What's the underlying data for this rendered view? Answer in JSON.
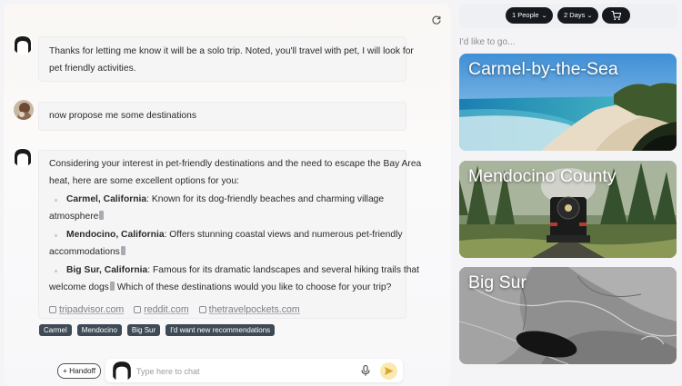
{
  "chat": {
    "messages": [
      {
        "role": "assistant",
        "lines": [
          "Thanks for letting me know it will be a solo trip. Noted, you'll travel with pet, I will look for",
          "pet friendly activities."
        ]
      },
      {
        "role": "user",
        "text": "now propose me some destinations"
      },
      {
        "role": "assistant",
        "intro": [
          "Considering your interest in pet-friendly destinations and the need to escape the Bay Area",
          "heat, here are some excellent options for you:"
        ],
        "bullets": [
          {
            "name": "Carmel, California",
            "line1": ": Known for its dog-friendly beaches and charming village",
            "line2": "atmosphere"
          },
          {
            "name": "Mendocino, California",
            "line1": ": Offers stunning coastal views and numerous pet-friendly",
            "line2": "accommodations"
          },
          {
            "name": "Big Sur, California",
            "line1": ": Famous for its dramatic landscapes and several hiking trails that",
            "line2a": "welcome dogs",
            "line2b": " Which of these destinations would you like to choose for your trip?"
          }
        ],
        "sources": [
          "tripadvisor.com",
          "reddit.com",
          "thetravelpockets.com"
        ]
      }
    ],
    "suggestions": [
      "Carmel",
      "Mendocino",
      "Big Sur",
      "I'd want new recommendations"
    ],
    "handoff_label": "+ Handoff",
    "input_placeholder": "Type here to chat",
    "icons": {
      "refresh": "refresh-icon",
      "mic": "microphone-icon",
      "send": "send-icon",
      "source": "external-link-icon"
    }
  },
  "trip": {
    "people": "1 People",
    "days": "2 Days",
    "cart_icon": "cart-icon",
    "label": "I'd like to go...",
    "destinations": [
      {
        "title": "Carmel-by-the-Sea"
      },
      {
        "title": "Mendocino County"
      },
      {
        "title": "Big Sur"
      }
    ]
  },
  "colors": {
    "chip_bg": "#3e4a55",
    "pill_bg": "#16191d",
    "send_bg": "#fbe9b4"
  }
}
